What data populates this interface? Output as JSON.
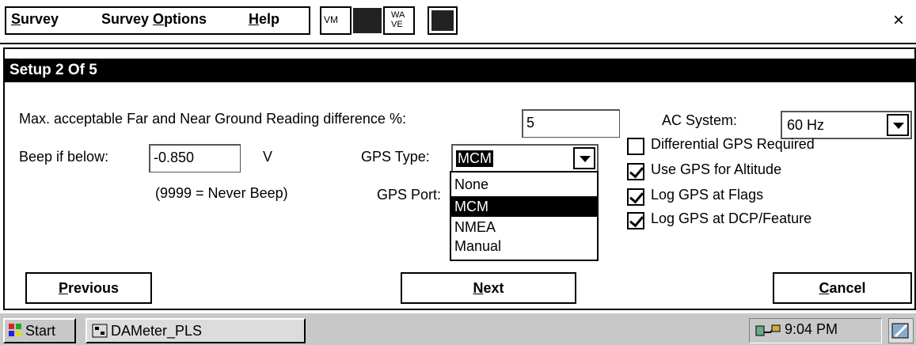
{
  "menu": {
    "items": [
      {
        "label": "Survey",
        "mnemonic": "S"
      },
      {
        "label": "Survey Options",
        "mnemonic": "O"
      },
      {
        "label": "Help",
        "mnemonic": "H"
      }
    ],
    "toolbar_vm": "VM",
    "toolbar_wave_top": "WA",
    "toolbar_wave_bottom": "VE",
    "close": "×"
  },
  "dialog": {
    "title": "Setup 2 Of 5",
    "diff_label": "Max. acceptable Far and Near Ground Reading difference %:",
    "diff_value": "5",
    "ac_label": "AC System:",
    "ac_value": "60 Hz",
    "beep_label": "Beep if below:",
    "beep_value": "-0.850",
    "beep_unit": "V",
    "beep_note": "(9999 = Never Beep)",
    "gps_type_label": "GPS Type:",
    "gps_type_value": "MCM",
    "gps_port_label": "GPS Port:",
    "gps_options": [
      "None",
      "MCM",
      "NMEA",
      "Manual"
    ],
    "gps_selected_index": 1,
    "checkboxes": [
      {
        "label": "Differential GPS Required",
        "checked": false
      },
      {
        "label": "Use GPS for Altitude",
        "checked": true
      },
      {
        "label": "Log GPS at Flags",
        "checked": true
      },
      {
        "label": "Log GPS at DCP/Feature",
        "checked": true
      }
    ],
    "buttons": {
      "previous": "Previous",
      "next": "Next",
      "cancel": "Cancel"
    }
  },
  "taskbar": {
    "start": "Start",
    "task_label": "DAMeter_PLS",
    "task_icon_text": "Pl☐\nPL S",
    "clock": "9:04 PM"
  }
}
